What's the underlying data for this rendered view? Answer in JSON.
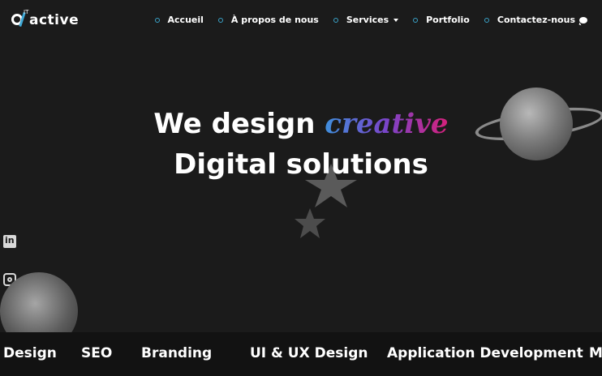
{
  "logo": {
    "text": "active",
    "superscript": "IT"
  },
  "nav": [
    {
      "label": "Accueil"
    },
    {
      "label": "À propos de nous"
    },
    {
      "label": "Services"
    },
    {
      "label": "Portfolio"
    },
    {
      "label": "Contactez-nous"
    }
  ],
  "hero": {
    "line1_prefix": "We design",
    "line1_accent": "creative",
    "line2": "Digital solutions"
  },
  "ticker": [
    "Design",
    "SEO",
    "Branding",
    "UI & UX Design",
    "Application Development",
    "M"
  ],
  "colors": {
    "background": "#1b1b1b",
    "accent_blue": "#3f8fdc",
    "accent_pink": "#d6207a"
  },
  "icons": [
    "linkedin-icon",
    "instagram-icon",
    "chat-icon",
    "chevron-down-icon"
  ]
}
